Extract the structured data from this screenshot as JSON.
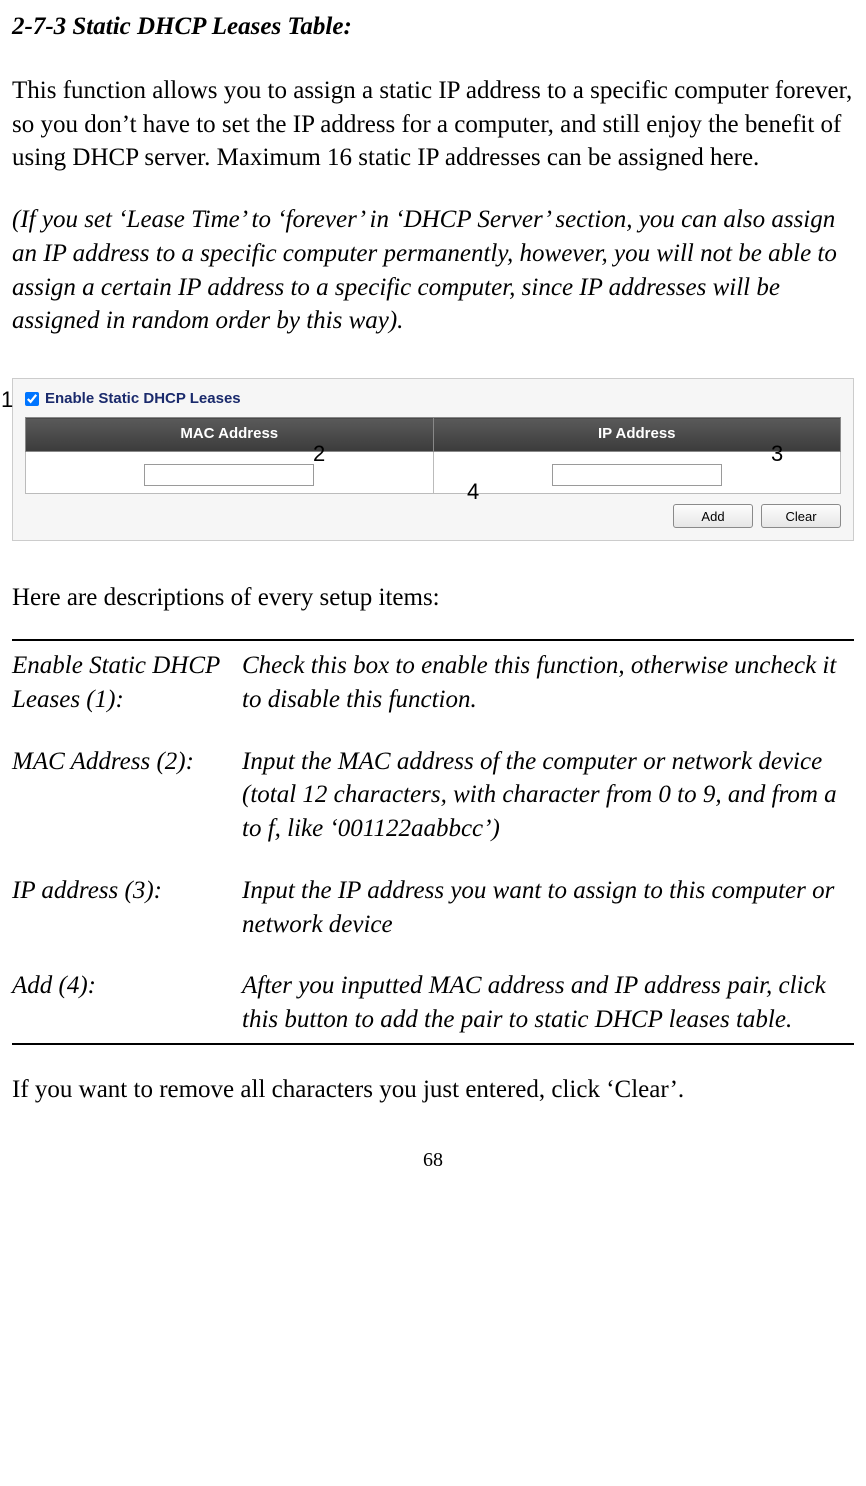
{
  "section_title": "2-7-3 Static DHCP Leases Table:",
  "para1": "This function allows you to assign a static IP address to a specific computer forever, so you don’t have to set the IP address for a computer, and still enjoy the benefit of using DHCP server. Maximum 16 static IP addresses can be assigned here.",
  "para2": "(If you set ‘Lease Time’ to ‘forever’ in ‘DHCP Server’ section, you can also assign an IP address to a specific computer permanently, however, you will not be able to assign a certain IP address to a specific computer, since IP addresses will be assigned in random order by this way).",
  "diagram": {
    "enable_label": "Enable Static DHCP Leases",
    "enable_checked": true,
    "columns": {
      "mac": "MAC Address",
      "ip": "IP Address"
    },
    "inputs": {
      "mac_value": "",
      "ip_value": ""
    },
    "buttons": {
      "add": "Add",
      "clear": "Clear"
    },
    "callouts": {
      "c1": "1",
      "c2": "2",
      "c3": "3",
      "c4": "4"
    }
  },
  "desc_intro": "Here are descriptions of every setup items:",
  "descriptions": {
    "enable": {
      "label": "Enable Static DHCP Leases (1):",
      "text": "Check this box to enable this function, otherwise uncheck it to disable this function."
    },
    "mac": {
      "label": "MAC Address (2):",
      "text": "Input the MAC address of the computer or network device (total 12 characters, with character from 0 to 9, and from a to f, like ‘001122aabbcc’)"
    },
    "ip": {
      "label": "IP address (3):",
      "text": "Input the IP address you want to assign to this computer or network device"
    },
    "add": {
      "label": "Add (4):",
      "text": "After you inputted MAC address and IP address pair, click this button to add the pair to static DHCP leases table."
    }
  },
  "footer_para": "If you want to remove all characters you just entered, click ‘Clear’.",
  "page_number": "68"
}
